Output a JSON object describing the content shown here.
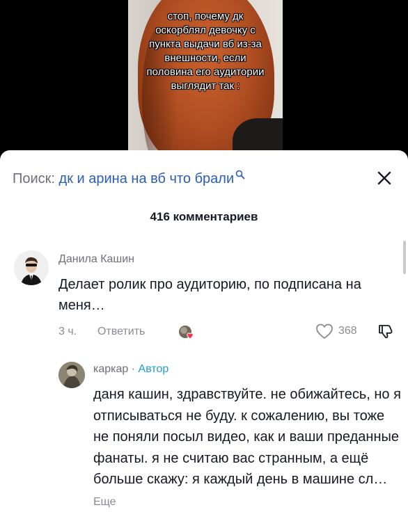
{
  "video": {
    "caption": "стоп, почему дк\nоскорблял девочку с\nпункта выдачи вб из-за\nвнешности, если\nполовина его аудитории\nвыглядит так :"
  },
  "search": {
    "label": "Поиск:",
    "query": "дк и арина на вб что брали"
  },
  "comments_header": {
    "count_label": "416 комментариев"
  },
  "comments": [
    {
      "author": "Данила Кашин",
      "text": "Делает ролик про аудиторию, по подписана на меня…",
      "time": "3 ч.",
      "reply_label": "Ответить",
      "likes": "368"
    }
  ],
  "reply": {
    "author": "каркар",
    "separator": " · ",
    "badge": "Автор",
    "text": "даня кашин, здравствуйте. не обижайтесь, но я отписываться не буду. к сожалению, вы тоже не поняли посыл видео, как и ваши преданные фанаты. я не считаю вас странным, а ещё больше скажу: я каждый день в машине сл…",
    "more_label": "Еще"
  },
  "colors": {
    "accent_link": "#2b5db5",
    "author_badge": "#20a0c8",
    "muted_text": "#8a8b91",
    "creator_heart": "#fe2c55"
  },
  "icons": [
    "search-icon",
    "close-icon",
    "heart-outline-icon",
    "dislike-icon",
    "creator-liked-heart-icon"
  ]
}
